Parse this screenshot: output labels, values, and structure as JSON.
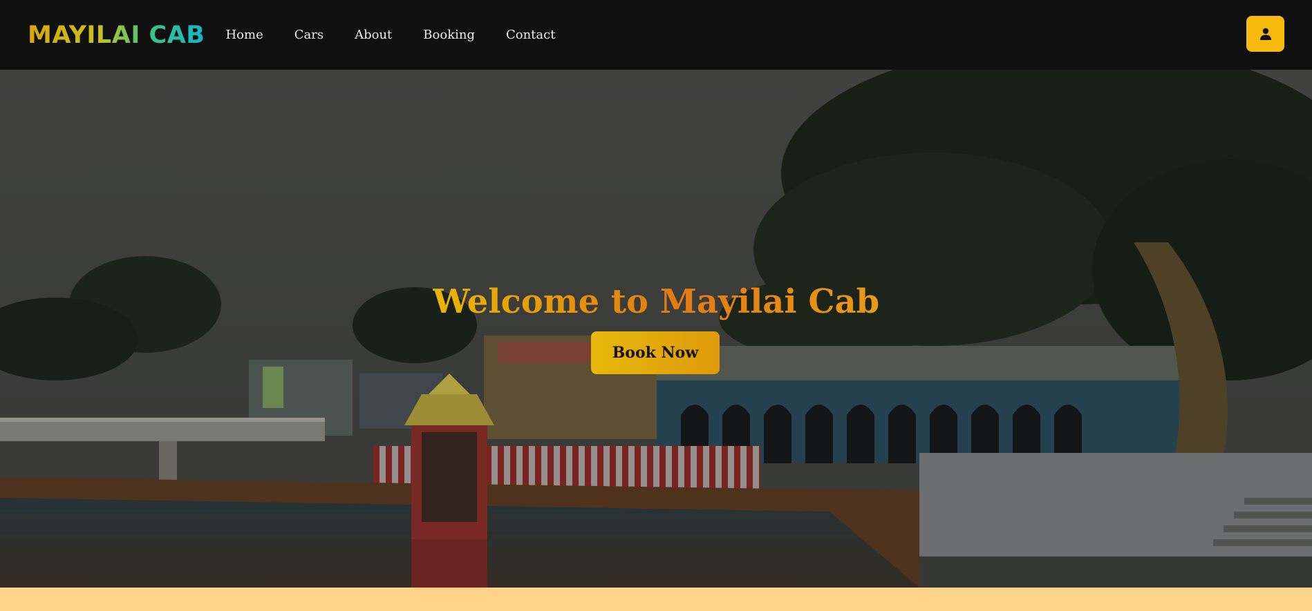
{
  "brand": {
    "logo_text": "MAYILAI CAB"
  },
  "nav": {
    "items": [
      {
        "label": "Home"
      },
      {
        "label": "Cars"
      },
      {
        "label": "About"
      },
      {
        "label": "Booking"
      },
      {
        "label": "Contact"
      }
    ],
    "user_icon": "user-icon"
  },
  "hero": {
    "title": "Welcome to Mayilai Cab",
    "cta_label": "Book Now",
    "background_image": "temple tank with gopuram, arcade and banyan tree (darkened)"
  },
  "colors": {
    "navbar_bg": "#101010",
    "accent": "#f6bb0c",
    "footer_strip": "#ffd48a"
  }
}
